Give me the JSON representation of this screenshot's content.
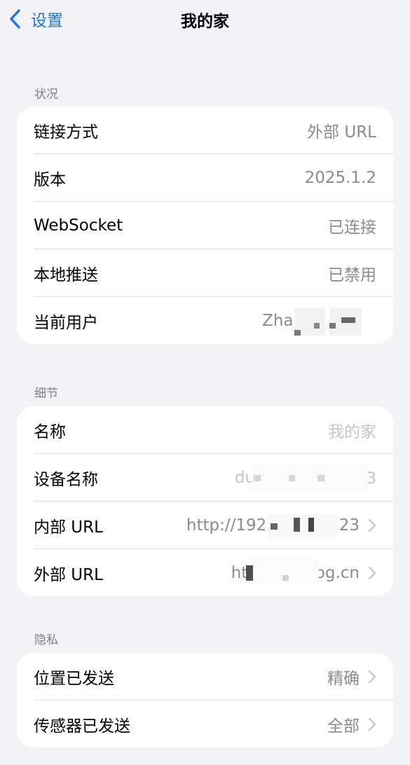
{
  "nav": {
    "back_label": "设置",
    "title": "我的家"
  },
  "sections": [
    {
      "header": "状况",
      "rows": [
        {
          "label": "链接方式",
          "value": "外部 URL"
        },
        {
          "label": "版本",
          "value": "2025.1.2"
        },
        {
          "label": "WebSocket",
          "value": "已连接"
        },
        {
          "label": "本地推送",
          "value": "已禁用"
        },
        {
          "label": "当前用户",
          "value": "Zhar"
        }
      ]
    },
    {
      "header": "细节",
      "rows": [
        {
          "label": "名称",
          "placeholder": "我的家"
        },
        {
          "label": "设备名称",
          "value": "dupi"
        },
        {
          "label": "内部 URL",
          "value": "http://192.168 … 123"
        },
        {
          "label": "外部 URL",
          "value": "https:// … og.cn"
        }
      ]
    },
    {
      "header": "隐私",
      "rows": [
        {
          "label": "位置已发送",
          "value": "精确"
        },
        {
          "label": "传感器已发送",
          "value": "全部"
        }
      ]
    }
  ],
  "icons": {
    "back": "chevron-left-icon",
    "disclosure": "chevron-right-icon"
  },
  "colors": {
    "accent": "#1f74e8",
    "background": "#f2f2f7",
    "secondary_text": "#8a8a8f",
    "placeholder_text": "#c5c5c9",
    "chevron": "#c7c7cc"
  }
}
